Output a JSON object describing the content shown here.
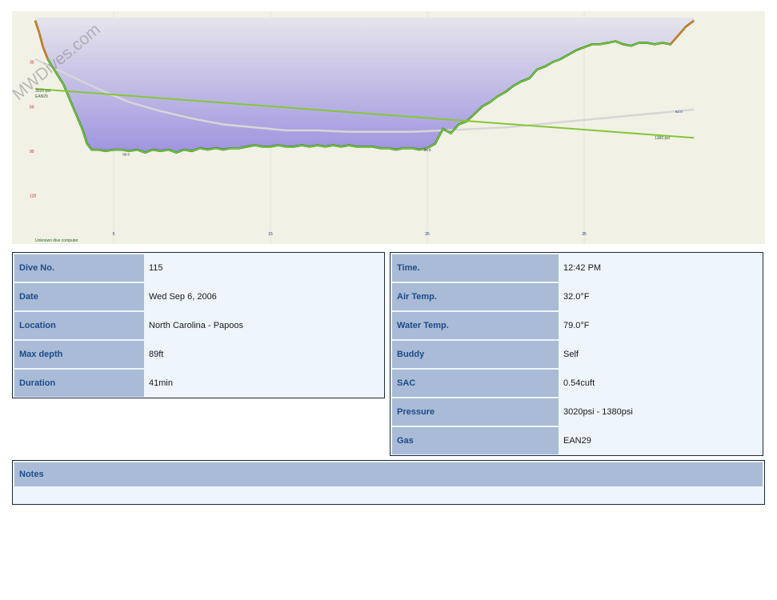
{
  "chart_data": {
    "type": "area",
    "watermark": "MWDives.com",
    "footer_text": "Unknown dive computer",
    "depth_unit": "ft",
    "y_ticks": [
      30,
      60,
      90,
      120
    ],
    "x_ticks": [
      5,
      15,
      25,
      35
    ],
    "xlim": [
      0,
      46
    ],
    "ylim": [
      0,
      137
    ],
    "depth_profile": {
      "name": "depth",
      "x": [
        0,
        0.25,
        0.5,
        0.8,
        1.2,
        1.8,
        2.4,
        3.0,
        3.3,
        3.6,
        4.0,
        4.5,
        5.0,
        5.5,
        6.0,
        6.5,
        7.0,
        7.5,
        8.0,
        8.5,
        9.0,
        9.5,
        10.0,
        10.5,
        11.0,
        11.5,
        12.0,
        12.5,
        13.0,
        13.5,
        14.0,
        14.5,
        15.0,
        15.5,
        16.0,
        16.5,
        17.0,
        17.5,
        18.0,
        18.5,
        19.0,
        19.5,
        20.0,
        20.5,
        21.0,
        21.5,
        22.0,
        22.5,
        23.0,
        23.5,
        24.0,
        24.5,
        25.0,
        25.5,
        26.0,
        26.5,
        27.0,
        27.5,
        28.0,
        28.5,
        29.0,
        29.5,
        30.0,
        30.5,
        31.0,
        31.5,
        32.0,
        32.5,
        33.0,
        33.5,
        34.0,
        34.5,
        35.0,
        35.5,
        36.0,
        36.5,
        37.0,
        37.5,
        38.0,
        38.5,
        39.0,
        39.5,
        40.0,
        40.5,
        41.0,
        41.5,
        42.0
      ],
      "y": [
        2,
        10,
        20,
        28,
        35,
        45,
        60,
        75,
        85,
        89,
        89,
        90,
        89,
        89,
        90,
        89,
        91,
        89,
        90,
        89,
        91,
        89,
        90,
        88,
        89,
        88,
        89,
        88,
        88,
        87,
        86,
        87,
        87,
        86,
        87,
        87,
        86,
        87,
        86,
        87,
        86,
        87,
        86,
        87,
        87,
        87,
        88,
        88,
        89,
        88,
        88,
        89,
        88,
        85,
        75,
        78,
        72,
        70,
        65,
        60,
        57,
        53,
        50,
        46,
        43,
        41,
        35,
        33,
        30,
        28,
        25,
        22,
        20,
        18,
        18,
        17,
        16,
        18,
        19,
        17,
        17,
        18,
        17,
        18,
        12,
        6,
        2
      ],
      "annotations": [
        {
          "x": 5.8,
          "y": 93,
          "label": "89.0"
        },
        {
          "x": 25.0,
          "y": 90,
          "label": "88.0"
        }
      ]
    },
    "pressure": {
      "name": "tank pressure",
      "start_label": "3020 psi",
      "gas_label": "EAN29",
      "end_label": "1380 psi",
      "x": [
        0,
        42
      ],
      "y": [
        48,
        81
      ]
    },
    "temperature": {
      "name": "temperature",
      "end_label": "62.0",
      "x": [
        0,
        2,
        4,
        6,
        8,
        10,
        12,
        14,
        16,
        18,
        20,
        22,
        24,
        26,
        28,
        30,
        32,
        34,
        36,
        38,
        40,
        42
      ],
      "y": [
        28,
        38,
        48,
        57,
        63,
        68,
        72,
        74,
        76,
        76,
        77,
        77,
        77,
        76,
        75,
        74,
        72,
        70,
        68,
        66,
        64,
        62
      ]
    },
    "colors": {
      "plot_background": "#f2f1e6",
      "fill_top": "#e6e5ec",
      "fill_bottom": "#9f94df",
      "depth_line_dark": "#0f5d1e",
      "depth_line_light": "#7bd32d",
      "ascent_warning": "#e07a1b",
      "pressure_line": "#87c536",
      "temperature_line": "#d6d6d6",
      "depth_tick_labels": "#c0282b",
      "time_tick_labels": "#1a3a8a"
    }
  },
  "left_table": {
    "rows": [
      {
        "label": "Dive No.",
        "value": "115"
      },
      {
        "label": "Date",
        "value": "Wed Sep 6, 2006"
      },
      {
        "label": "Location",
        "value": "North Carolina - Papoos"
      },
      {
        "label": "Max depth",
        "value": "89ft"
      },
      {
        "label": "Duration",
        "value": "41min"
      }
    ]
  },
  "right_table": {
    "rows": [
      {
        "label": "Time.",
        "value": "12:42 PM"
      },
      {
        "label": "Air Temp.",
        "value": "32.0°F"
      },
      {
        "label": "Water Temp.",
        "value": "79.0°F"
      },
      {
        "label": "Buddy",
        "value": "Self"
      },
      {
        "label": "SAC",
        "value": "0.54cuft"
      },
      {
        "label": "Pressure",
        "value": "3020psi - 1380psi"
      },
      {
        "label": "Gas",
        "value": "EAN29"
      }
    ]
  },
  "notes": {
    "label": "Notes",
    "value": ""
  }
}
